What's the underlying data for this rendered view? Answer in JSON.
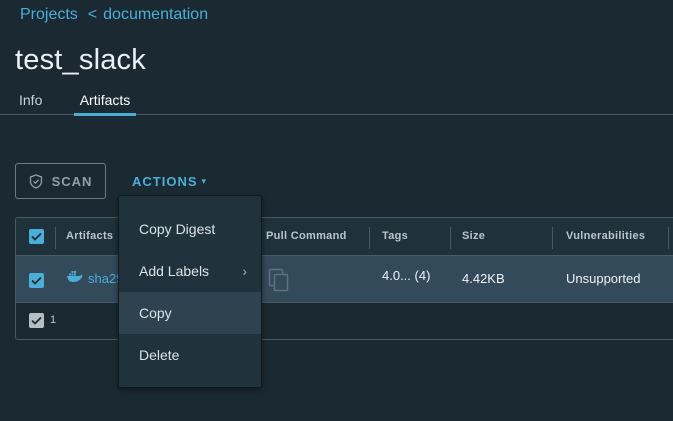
{
  "breadcrumb": {
    "root": "Projects",
    "separator": "<",
    "current": "documentation"
  },
  "page_title": "test_slack",
  "tabs": [
    {
      "label": "Info",
      "active": false
    },
    {
      "label": "Artifacts",
      "active": true
    }
  ],
  "toolbar": {
    "scan_label": "SCAN",
    "actions_label": "ACTIONS",
    "scan_icon": "shield-icon",
    "actions_icon": "chevron-down-icon"
  },
  "table": {
    "columns": [
      "Artifacts",
      "Pull Command",
      "Tags",
      "Size",
      "Vulnerabilities"
    ],
    "rows": [
      {
        "selected": true,
        "artifact": "sha25",
        "artifact_icon": "docker-icon",
        "pull_command_icon": "copy-icon",
        "tags": "4.0... (4)",
        "size": "4.42KB",
        "vulnerabilities": "Unsupported"
      }
    ],
    "footer_count": "1"
  },
  "actions_menu": {
    "items": [
      {
        "label": "Copy Digest",
        "has_submenu": false
      },
      {
        "label": "Add Labels",
        "has_submenu": true
      },
      {
        "label": "Copy",
        "has_submenu": false,
        "hovered": true
      },
      {
        "label": "Delete",
        "has_submenu": false
      }
    ]
  },
  "colors": {
    "background": "#1b2a32",
    "accent": "#4aaed9",
    "selected_row": "#324a5a",
    "menu_background": "#20333d"
  }
}
